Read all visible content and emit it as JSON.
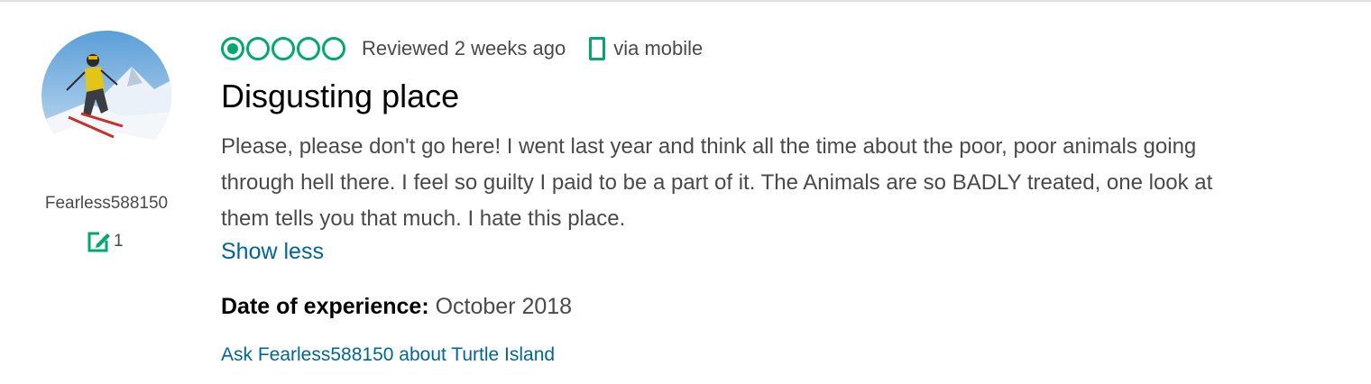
{
  "review": {
    "rating": 1,
    "rating_max": 5,
    "review_date": "Reviewed 2 weeks ago",
    "via": "via mobile",
    "title": "Disgusting place",
    "body": "Please, please don't go here! I went last year and think all the time about the poor, poor animals going through hell there. I feel so guilty I paid to be a part of it. The Animals are so BADLY treated, one look at them tells you that much. I hate this place.",
    "show_less": "Show less",
    "experience_label": "Date of experience:",
    "experience_value": "October 2018",
    "ask_link": "Ask Fearless588150 about Turtle Island"
  },
  "reviewer": {
    "username": "Fearless588150",
    "contributions": "1",
    "avatar": "skier-photo",
    "contribution_icon": "edit-note-icon"
  },
  "colors": {
    "accent_green": "#00aa6c",
    "link_blue": "#006699",
    "text_gray": "#4a4a4a",
    "title_black": "#000000"
  },
  "icons": [
    "bubble-rating-icon",
    "mobile-phone-icon",
    "edit-note-icon"
  ]
}
